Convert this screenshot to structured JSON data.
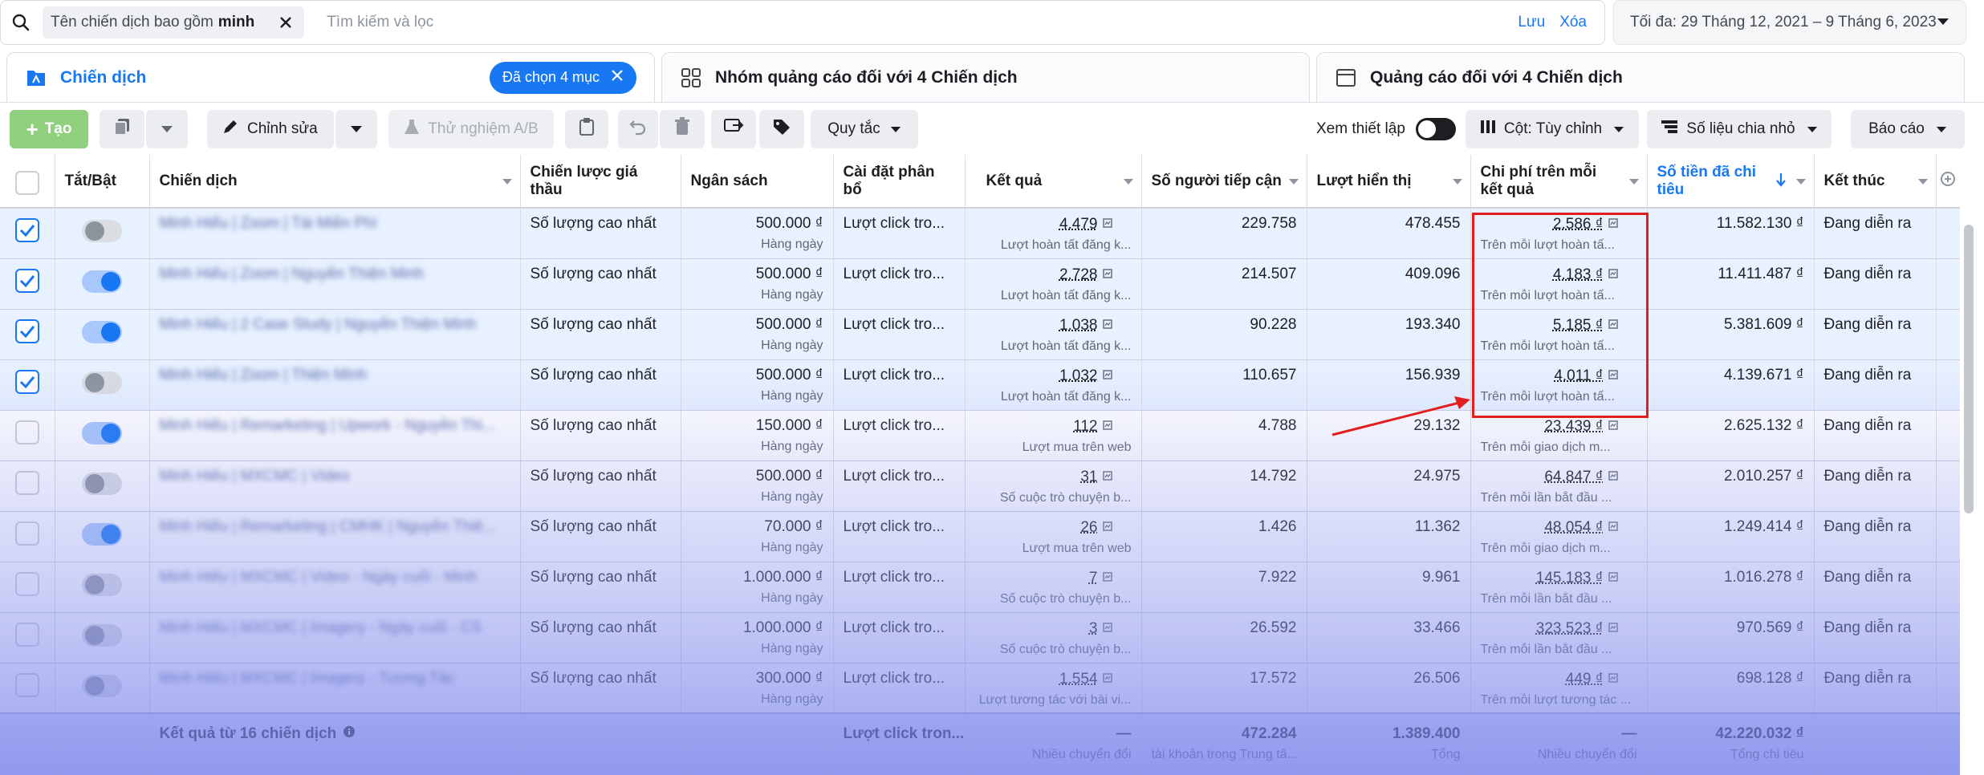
{
  "search": {
    "chip_label": "Tên chiến dịch bao gồm",
    "chip_value": "minh",
    "placeholder": "Tìm kiếm và lọc",
    "save_label": "Lưu",
    "clear_label": "Xóa"
  },
  "date_range": "Tối đa: 29 Tháng 12, 2021 – 9 Tháng 6, 2023",
  "tabs": [
    {
      "label": "Chiến dịch",
      "badge": "Đã chọn 4 mục"
    },
    {
      "label": "Nhóm quảng cáo đối với 4 Chiến dịch"
    },
    {
      "label": "Quảng cáo đối với 4 Chiến dịch"
    }
  ],
  "toolbar": {
    "create": "Tạo",
    "edit": "Chỉnh sửa",
    "ab_test": "Thử nghiệm A/B",
    "rules": "Quy tắc",
    "view_setup": "Xem thiết lập",
    "columns": "Cột: Tùy chỉnh",
    "breakdown": "Số liệu chia nhỏ",
    "reports": "Báo cáo"
  },
  "columns": [
    "Tắt/Bật",
    "Chiến dịch",
    "Chiến lược giá thầu",
    "Ngân sách",
    "Cài đặt phân bổ",
    "Kết quả",
    "Số người tiếp cận",
    "Lượt hiển thị",
    "Chi phí trên mỗi kết quả",
    "Số tiền đã chi tiêu",
    "Kết thúc"
  ],
  "rows": [
    {
      "checked": true,
      "on": false,
      "name": "Minh Hiếu | Zoom | Tài Miễn Phí",
      "bid": "Số lượng cao nhất",
      "budget": "500.000 ₫",
      "budget_sub": "Hàng ngày",
      "attr": "Lượt click tro...",
      "result": "4.479",
      "result_sub": "Lượt hoàn tất đăng k...",
      "reach": "229.758",
      "impr": "478.455",
      "cpr": "2.586 ₫",
      "cpr_sub": "Trên mỗi lượt hoàn tấ...",
      "spent": "11.582.130 ₫",
      "end": "Đang diễn ra"
    },
    {
      "checked": true,
      "on": true,
      "name": "Minh Hiếu | Zoom | Nguyễn Thiện Minh",
      "bid": "Số lượng cao nhất",
      "budget": "500.000 ₫",
      "budget_sub": "Hàng ngày",
      "attr": "Lượt click tro...",
      "result": "2.728",
      "result_sub": "Lượt hoàn tất đăng k...",
      "reach": "214.507",
      "impr": "409.096",
      "cpr": "4.183 ₫",
      "cpr_sub": "Trên mỗi lượt hoàn tấ...",
      "spent": "11.411.487 ₫",
      "end": "Đang diễn ra"
    },
    {
      "checked": true,
      "on": true,
      "name": "Minh Hiếu | 2 Case Study | Nguyễn Thiện Minh",
      "bid": "Số lượng cao nhất",
      "budget": "500.000 ₫",
      "budget_sub": "Hàng ngày",
      "attr": "Lượt click tro...",
      "result": "1.038",
      "result_sub": "Lượt hoàn tất đăng k...",
      "reach": "90.228",
      "impr": "193.340",
      "cpr": "5.185 ₫",
      "cpr_sub": "Trên mỗi lượt hoàn tấ...",
      "spent": "5.381.609 ₫",
      "end": "Đang diễn ra"
    },
    {
      "checked": true,
      "on": false,
      "name": "Minh Hiếu | Zoom | Thiện Minh",
      "bid": "Số lượng cao nhất",
      "budget": "500.000 ₫",
      "budget_sub": "Hàng ngày",
      "attr": "Lượt click tro...",
      "result": "1.032",
      "result_sub": "Lượt hoàn tất đăng k...",
      "reach": "110.657",
      "impr": "156.939",
      "cpr": "4.011 ₫",
      "cpr_sub": "Trên mỗi lượt hoàn tấ...",
      "spent": "4.139.671 ₫",
      "end": "Đang diễn ra"
    },
    {
      "checked": false,
      "on": true,
      "name": "Minh Hiếu | Remarketing | Upwork - Nguyễn Thi...",
      "bid": "Số lượng cao nhất",
      "budget": "150.000 ₫",
      "budget_sub": "Hàng ngày",
      "attr": "Lượt click tro...",
      "result": "112",
      "result_sub": "Lượt mua trên web",
      "reach": "4.788",
      "impr": "29.132",
      "cpr": "23.439 ₫",
      "cpr_sub": "Trên mỗi giao dịch m...",
      "spent": "2.625.132 ₫",
      "end": "Đang diễn ra"
    },
    {
      "checked": false,
      "on": false,
      "name": "Minh Hiếu | MXCMC | Video",
      "bid": "Số lượng cao nhất",
      "budget": "500.000 ₫",
      "budget_sub": "Hàng ngày",
      "attr": "Lượt click tro...",
      "result": "31",
      "result_sub": "Số cuộc trò chuyện b...",
      "reach": "14.792",
      "impr": "24.975",
      "cpr": "64.847 ₫",
      "cpr_sub": "Trên mỗi lần bắt đầu ...",
      "spent": "2.010.257 ₫",
      "end": "Đang diễn ra"
    },
    {
      "checked": false,
      "on": true,
      "name": "Minh Hiếu | Remarketing | CMHK | Nguyễn Thiệ...",
      "bid": "Số lượng cao nhất",
      "budget": "70.000 ₫",
      "budget_sub": "Hàng ngày",
      "attr": "Lượt click tro...",
      "result": "26",
      "result_sub": "Lượt mua trên web",
      "reach": "1.426",
      "impr": "11.362",
      "cpr": "48.054 ₫",
      "cpr_sub": "Trên mỗi giao dịch m...",
      "spent": "1.249.414 ₫",
      "end": "Đang diễn ra"
    },
    {
      "checked": false,
      "on": false,
      "name": "Minh Hiếu | MXCMC | Video - Ngày cuối - Minh",
      "bid": "Số lượng cao nhất",
      "budget": "1.000.000 ₫",
      "budget_sub": "Hàng ngày",
      "attr": "Lượt click tro...",
      "result": "7",
      "result_sub": "Số cuộc trò chuyện b...",
      "reach": "7.922",
      "impr": "9.961",
      "cpr": "145.183 ₫",
      "cpr_sub": "Trên mỗi lần bắt đầu ...",
      "spent": "1.016.278 ₫",
      "end": "Đang diễn ra"
    },
    {
      "checked": false,
      "on": false,
      "name": "Minh Hiếu | MXCMC | Imagery - Ngày cuối - CS",
      "bid": "Số lượng cao nhất",
      "budget": "1.000.000 ₫",
      "budget_sub": "Hàng ngày",
      "attr": "Lượt click tro...",
      "result": "3",
      "result_sub": "Số cuộc trò chuyện b...",
      "reach": "26.592",
      "impr": "33.466",
      "cpr": "323.523 ₫",
      "cpr_sub": "Trên mỗi lần bắt đầu ...",
      "spent": "970.569 ₫",
      "end": "Đang diễn ra"
    },
    {
      "checked": false,
      "on": false,
      "name": "Minh Hiếu | MXCMC | Imagery - Tương Tác",
      "bid": "Số lượng cao nhất",
      "budget": "300.000 ₫",
      "budget_sub": "Hàng ngày",
      "attr": "Lượt click tro...",
      "result": "1.554",
      "result_sub": "Lượt tương tác với bài vi...",
      "reach": "17.572",
      "impr": "26.506",
      "cpr": "449 ₫",
      "cpr_sub": "Trên mỗi lượt tương tác ...",
      "spent": "698.128 ₫",
      "end": "Đang diễn ra"
    }
  ],
  "footer": {
    "label": "Kết quả từ 16 chiến dịch",
    "attr": "Lượt click tron...",
    "result": "—",
    "result_sub": "Nhiều chuyển đổi",
    "reach": "472.284",
    "reach_sub": "tài khoản trong Trung tâ...",
    "impr": "1.389.400",
    "impr_sub": "Tổng",
    "cpr": "—",
    "cpr_sub": "Nhiều chuyển đổi",
    "spent": "42.220.032 ₫",
    "spent_sub": "Tổng chi tiêu"
  },
  "colors": {
    "accent": "#1877f2",
    "highlight": "#e21f1f",
    "create_button": "#8fcf7e"
  }
}
